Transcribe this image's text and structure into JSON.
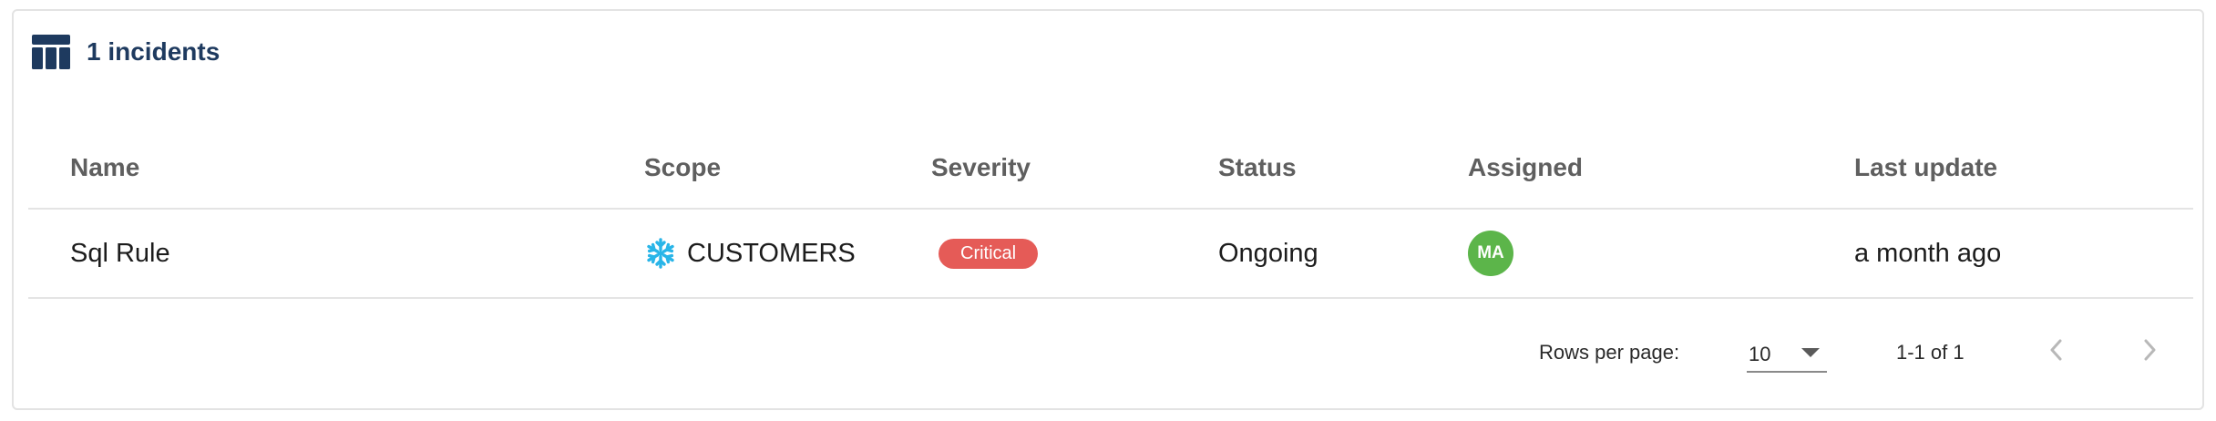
{
  "header": {
    "title": "1 incidents",
    "icon": "table-icon"
  },
  "table": {
    "columns": [
      "Name",
      "Scope",
      "Severity",
      "Status",
      "Assigned",
      "Last update"
    ],
    "rows": [
      {
        "name": "Sql Rule",
        "scope": "CUSTOMERS",
        "scope_icon": "snowflake-icon",
        "severity": "Critical",
        "status": "Ongoing",
        "assigned_initials": "MA",
        "last_update": "a month ago"
      }
    ]
  },
  "pagination": {
    "rows_per_page_label": "Rows per page:",
    "rows_per_page_value": "10",
    "range_text": "1-1 of 1"
  },
  "colors": {
    "header_text": "#1e3a5f",
    "critical_badge": "#e55b57",
    "avatar": "#5cb54a",
    "snowflake": "#29b5e8"
  }
}
